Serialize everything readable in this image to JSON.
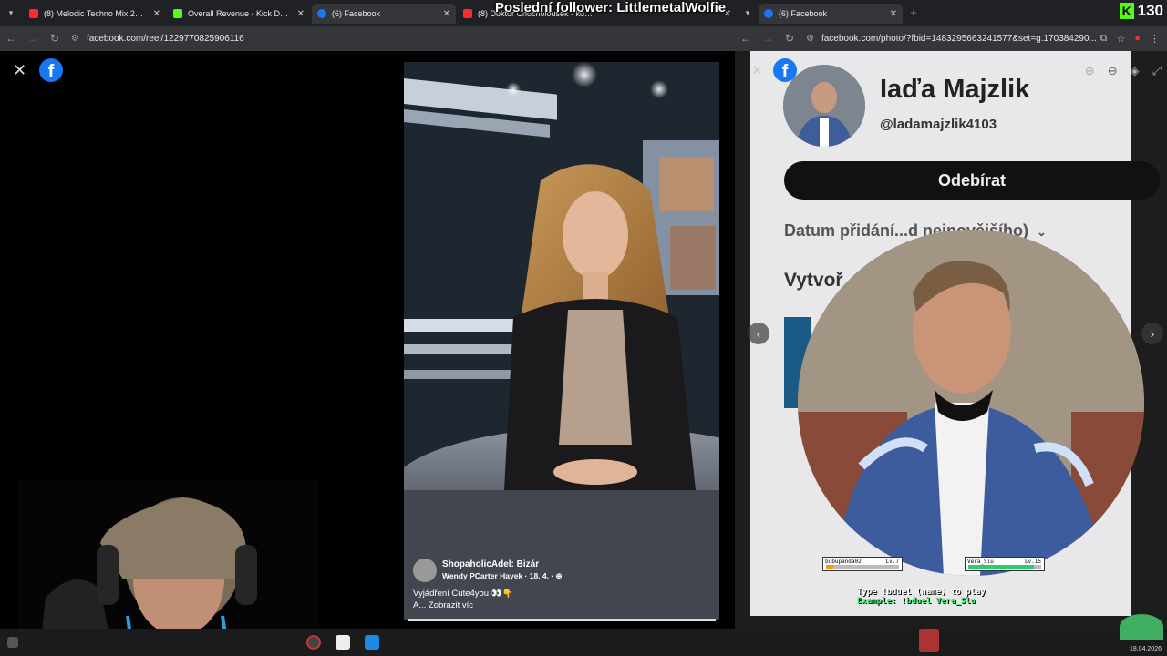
{
  "overlay": {
    "title": "Poslední follower: LittlemetalWolfie",
    "kick_count": "130",
    "kick_logo": "K"
  },
  "tabs": [
    {
      "title": "(8) Melodic Techno Mix 2016 (W",
      "icon": "youtube",
      "close": "✕"
    },
    {
      "title": "Overall Revenue - Kick Dashboa",
      "icon": "kick",
      "close": "✕"
    },
    {
      "title": "(6) Facebook",
      "icon": "facebook",
      "close": "✕"
    },
    {
      "title": "(8) Doktor Chocholoušek - kd…",
      "icon": "youtube",
      "close": "✕"
    },
    {
      "title": "(6) Facebook",
      "icon": "facebook",
      "close": "✕"
    }
  ],
  "left_browser": {
    "url": "facebook.com/reel/1229770825906116"
  },
  "right_browser": {
    "url": "facebook.com/photo/?fbid=1483295663241577&set=g.170384290..."
  },
  "reel": {
    "close": "✕",
    "fb_letter": "f",
    "page_name": "ShopaholicAdel: Bizár",
    "subline": "Wendy PCarter Hayek · 18. 4. · ⊕",
    "description": "Vyjádření Cute4you 👀👇",
    "more": "A... Zobrazit víc"
  },
  "photo": {
    "close": "✕",
    "profile_name": "Iaďa Majzlik",
    "handle": "@ladamajzlik4103",
    "subscribe_label": "Odebírat",
    "sort_label": "Datum přidání...d nejnovějšího)",
    "created_label": "Vytvoř",
    "prev": "‹",
    "next": "›"
  },
  "duel": {
    "left": {
      "name": "bubupanda02",
      "level": "Lv.7",
      "hp": 0.1
    },
    "right": {
      "name": "Vera_Slu",
      "level": "Lv.15",
      "hp": 0.9
    },
    "instruction": "Type !bduel (name) to play",
    "example": "Example: !bduel Vera_Slu"
  },
  "taskbar": {
    "date": "18.04.2026"
  }
}
